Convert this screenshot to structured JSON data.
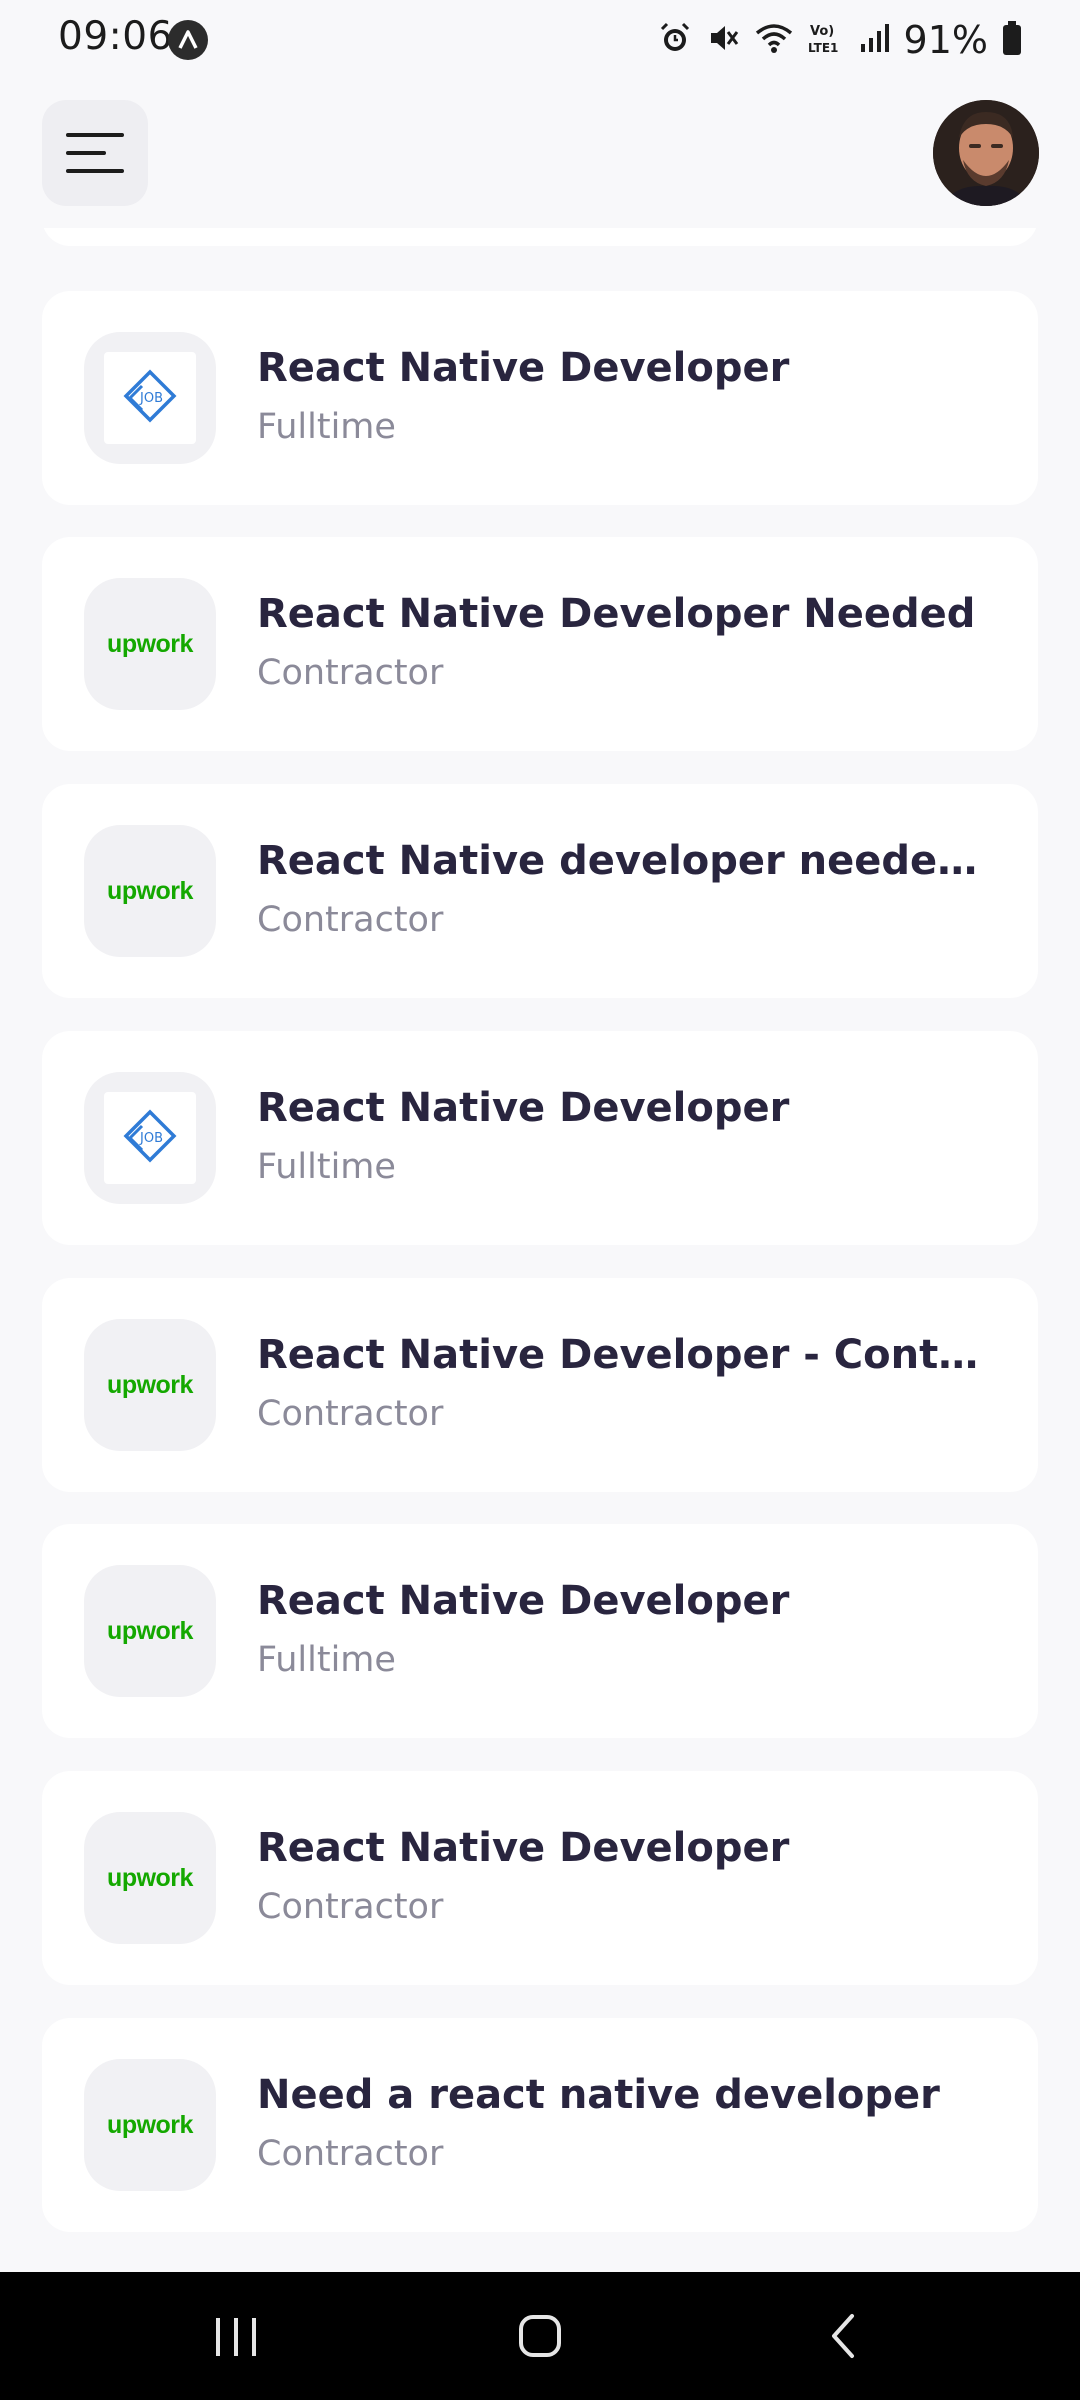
{
  "status_bar": {
    "time": "09:06",
    "battery": "91%",
    "network_label": "Vo) LTE1"
  },
  "header": {
    "menu_icon": "hamburger-menu-icon",
    "avatar": "user-avatar"
  },
  "jobs": [
    {
      "title": "React Native Developer",
      "type": "Fulltime",
      "logo": "job"
    },
    {
      "title": "React Native Developer Needed",
      "type": "Contractor",
      "logo": "upwork"
    },
    {
      "title": "React Native developer needed -...",
      "type": "Contractor",
      "logo": "upwork"
    },
    {
      "title": "React Native Developer",
      "type": "Fulltime",
      "logo": "job"
    },
    {
      "title": "React Native Developer - Contra...",
      "type": "Contractor",
      "logo": "upwork"
    },
    {
      "title": "React Native Developer",
      "type": "Fulltime",
      "logo": "upwork"
    },
    {
      "title": "React Native Developer",
      "type": "Contractor",
      "logo": "upwork"
    },
    {
      "title": "Need a react native developer",
      "type": "Contractor",
      "logo": "upwork"
    }
  ],
  "logos": {
    "upwork_text": "upwork",
    "job_text": "JOB"
  },
  "colors": {
    "title": "#29253f",
    "subtitle": "#8b8a99",
    "upwork_green": "#14a800",
    "job_blue": "#2f7bd6",
    "background": "#f8f8fa"
  }
}
